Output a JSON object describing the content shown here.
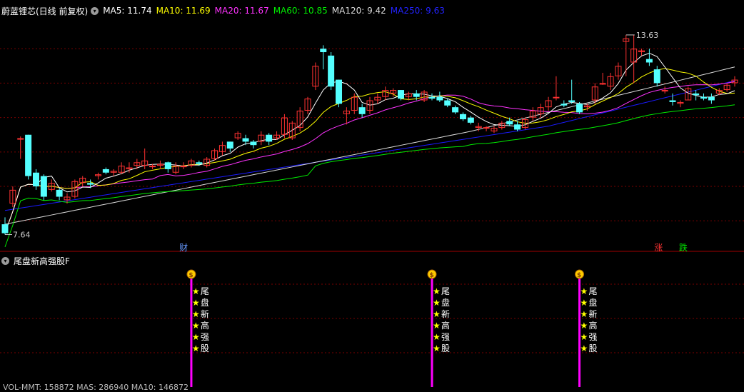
{
  "main_panel": {
    "title": "蔚蓝锂芯(日线 前复权)",
    "indicators": [
      {
        "label": "MA5: 11.74",
        "color": "#ffffff"
      },
      {
        "label": "MA10: 11.69",
        "color": "#ffff00"
      },
      {
        "label": "MA20: 11.67",
        "color": "#ff33ff"
      },
      {
        "label": "MA60: 10.85",
        "color": "#00ee00"
      },
      {
        "label": "MA120: 9.42",
        "color": "#dddddd"
      },
      {
        "label": "MA250: 9.63",
        "color": "#0000ff"
      }
    ],
    "high_label": "13.63",
    "low_label": "7.64",
    "markers": {
      "cai": "财",
      "zhang": "涨",
      "die": "跌"
    }
  },
  "sub_panel": {
    "title": "尾盘新高强股F",
    "signal_chars": [
      "尾",
      "盘",
      "新",
      "高",
      "强",
      "股"
    ],
    "signal_icon": "money-bag-icon",
    "star_icon": "star-icon"
  },
  "bottom_partial_text": "VOL-MMT: 158872 MAS: 286940 MA10: 146872",
  "colors": {
    "up": "#ff3232",
    "down": "#54ffff",
    "grid": "#7a0000",
    "signal": "#ff00ff",
    "star": "#ffff00"
  },
  "chart_data": {
    "type": "candlestick",
    "y_range": [
      7.3,
      14.0
    ],
    "ohlc": [
      [
        7.9,
        8.1,
        7.6,
        7.64
      ],
      [
        8.5,
        9.0,
        8.4,
        8.9
      ],
      [
        10.4,
        10.45,
        9.8,
        10.4
      ],
      [
        10.5,
        10.5,
        9.2,
        9.3
      ],
      [
        9.4,
        9.5,
        8.9,
        9.0
      ],
      [
        9.3,
        9.35,
        8.6,
        8.7
      ],
      [
        8.9,
        9.2,
        8.85,
        9.1
      ],
      [
        8.9,
        8.95,
        8.6,
        8.7
      ],
      [
        8.6,
        8.8,
        8.5,
        8.7
      ],
      [
        8.7,
        9.2,
        8.65,
        9.15
      ],
      [
        9.1,
        9.3,
        9.0,
        9.25
      ],
      [
        9.1,
        9.2,
        8.95,
        9.05
      ],
      [
        9.3,
        9.4,
        9.2,
        9.35
      ],
      [
        9.5,
        9.55,
        9.35,
        9.4
      ],
      [
        9.4,
        9.5,
        9.3,
        9.45
      ],
      [
        9.4,
        9.7,
        9.35,
        9.6
      ],
      [
        9.5,
        9.7,
        9.4,
        9.55
      ],
      [
        9.6,
        9.8,
        9.5,
        9.7
      ],
      [
        9.6,
        10.1,
        9.5,
        9.75
      ],
      [
        9.6,
        9.65,
        9.5,
        9.6
      ],
      [
        9.6,
        9.75,
        9.5,
        9.65
      ],
      [
        9.7,
        9.72,
        9.4,
        9.5
      ],
      [
        9.4,
        9.7,
        9.35,
        9.6
      ],
      [
        9.6,
        9.7,
        9.5,
        9.6
      ],
      [
        9.6,
        9.8,
        9.55,
        9.75
      ],
      [
        9.7,
        9.75,
        9.6,
        9.65
      ],
      [
        9.6,
        9.85,
        9.55,
        9.8
      ],
      [
        9.8,
        10.1,
        9.75,
        10.05
      ],
      [
        10.0,
        10.3,
        9.9,
        10.2
      ],
      [
        10.3,
        10.3,
        10.0,
        10.1
      ],
      [
        10.4,
        10.6,
        10.35,
        10.55
      ],
      [
        10.4,
        10.5,
        10.2,
        10.3
      ],
      [
        10.3,
        10.35,
        10.1,
        10.2
      ],
      [
        10.3,
        10.6,
        10.2,
        10.5
      ],
      [
        10.5,
        10.55,
        10.2,
        10.3
      ],
      [
        10.4,
        10.6,
        10.35,
        10.5
      ],
      [
        10.5,
        11.1,
        10.4,
        11.0
      ],
      [
        10.4,
        10.9,
        10.35,
        10.85
      ],
      [
        10.7,
        11.3,
        10.6,
        11.2
      ],
      [
        11.2,
        11.6,
        11.1,
        11.55
      ],
      [
        11.9,
        12.6,
        11.8,
        12.5
      ],
      [
        13.0,
        13.1,
        12.4,
        12.9
      ],
      [
        12.8,
        12.9,
        11.8,
        11.9
      ],
      [
        12.1,
        12.1,
        11.3,
        11.4
      ],
      [
        11.1,
        11.3,
        10.8,
        11.2
      ],
      [
        11.2,
        11.7,
        11.1,
        11.6
      ],
      [
        11.3,
        11.4,
        11.0,
        11.1
      ],
      [
        11.2,
        11.6,
        11.1,
        11.5
      ],
      [
        11.5,
        11.7,
        11.4,
        11.6
      ],
      [
        11.6,
        11.9,
        11.5,
        11.8
      ],
      [
        11.7,
        11.85,
        11.6,
        11.8
      ],
      [
        11.8,
        11.8,
        11.5,
        11.55
      ],
      [
        11.6,
        11.75,
        11.5,
        11.7
      ],
      [
        11.7,
        11.8,
        11.5,
        11.6
      ],
      [
        11.5,
        11.8,
        11.45,
        11.75
      ],
      [
        11.6,
        11.7,
        11.5,
        11.55
      ],
      [
        11.6,
        11.75,
        11.45,
        11.5
      ],
      [
        11.5,
        11.55,
        11.3,
        11.35
      ],
      [
        11.3,
        11.35,
        11.1,
        11.15
      ],
      [
        11.1,
        11.15,
        10.9,
        10.95
      ],
      [
        11.0,
        11.05,
        10.8,
        10.85
      ],
      [
        10.7,
        10.85,
        10.6,
        10.75
      ],
      [
        10.7,
        10.75,
        10.6,
        10.72
      ],
      [
        10.6,
        10.75,
        10.55,
        10.7
      ],
      [
        10.7,
        10.9,
        10.65,
        10.85
      ],
      [
        10.9,
        11.0,
        10.75,
        10.8
      ],
      [
        10.8,
        10.9,
        10.6,
        10.65
      ],
      [
        10.7,
        11.0,
        10.65,
        10.95
      ],
      [
        11.0,
        11.3,
        10.9,
        11.2
      ],
      [
        11.1,
        11.4,
        11.0,
        11.3
      ],
      [
        11.3,
        11.6,
        11.2,
        11.5
      ],
      [
        11.6,
        12.2,
        11.5,
        11.6
      ],
      [
        11.4,
        11.5,
        11.3,
        11.35
      ],
      [
        11.5,
        12.1,
        11.4,
        11.45
      ],
      [
        11.4,
        11.45,
        11.1,
        11.15
      ],
      [
        11.3,
        11.4,
        11.2,
        11.35
      ],
      [
        11.5,
        12.0,
        11.4,
        11.9
      ],
      [
        12.0,
        12.3,
        11.95,
        12.0
      ],
      [
        11.9,
        12.3,
        11.8,
        12.2
      ],
      [
        12.2,
        12.6,
        12.1,
        12.5
      ],
      [
        13.2,
        13.4,
        12.2,
        13.3
      ],
      [
        12.6,
        13.4,
        12.0,
        13.0
      ],
      [
        12.9,
        13.0,
        12.8,
        12.95
      ],
      [
        12.7,
        13.0,
        12.5,
        12.6
      ],
      [
        12.4,
        12.5,
        11.9,
        12.0
      ],
      [
        11.8,
        11.9,
        11.7,
        11.8
      ],
      [
        11.5,
        11.7,
        11.35,
        11.45
      ],
      [
        11.4,
        11.5,
        11.3,
        11.45
      ],
      [
        11.5,
        11.9,
        11.5,
        11.85
      ],
      [
        11.7,
        11.8,
        11.5,
        11.65
      ],
      [
        11.6,
        11.7,
        11.5,
        11.55
      ],
      [
        11.6,
        11.7,
        11.4,
        11.5
      ],
      [
        11.7,
        11.85,
        11.65,
        11.8
      ],
      [
        11.8,
        12.0,
        11.75,
        11.95
      ],
      [
        12.0,
        12.2,
        11.9,
        12.1
      ]
    ],
    "ma_series": [
      "MA5",
      "MA10",
      "MA20",
      "MA60",
      "MA120",
      "MA250"
    ],
    "signal_bars": [
      24,
      55,
      74
    ]
  }
}
